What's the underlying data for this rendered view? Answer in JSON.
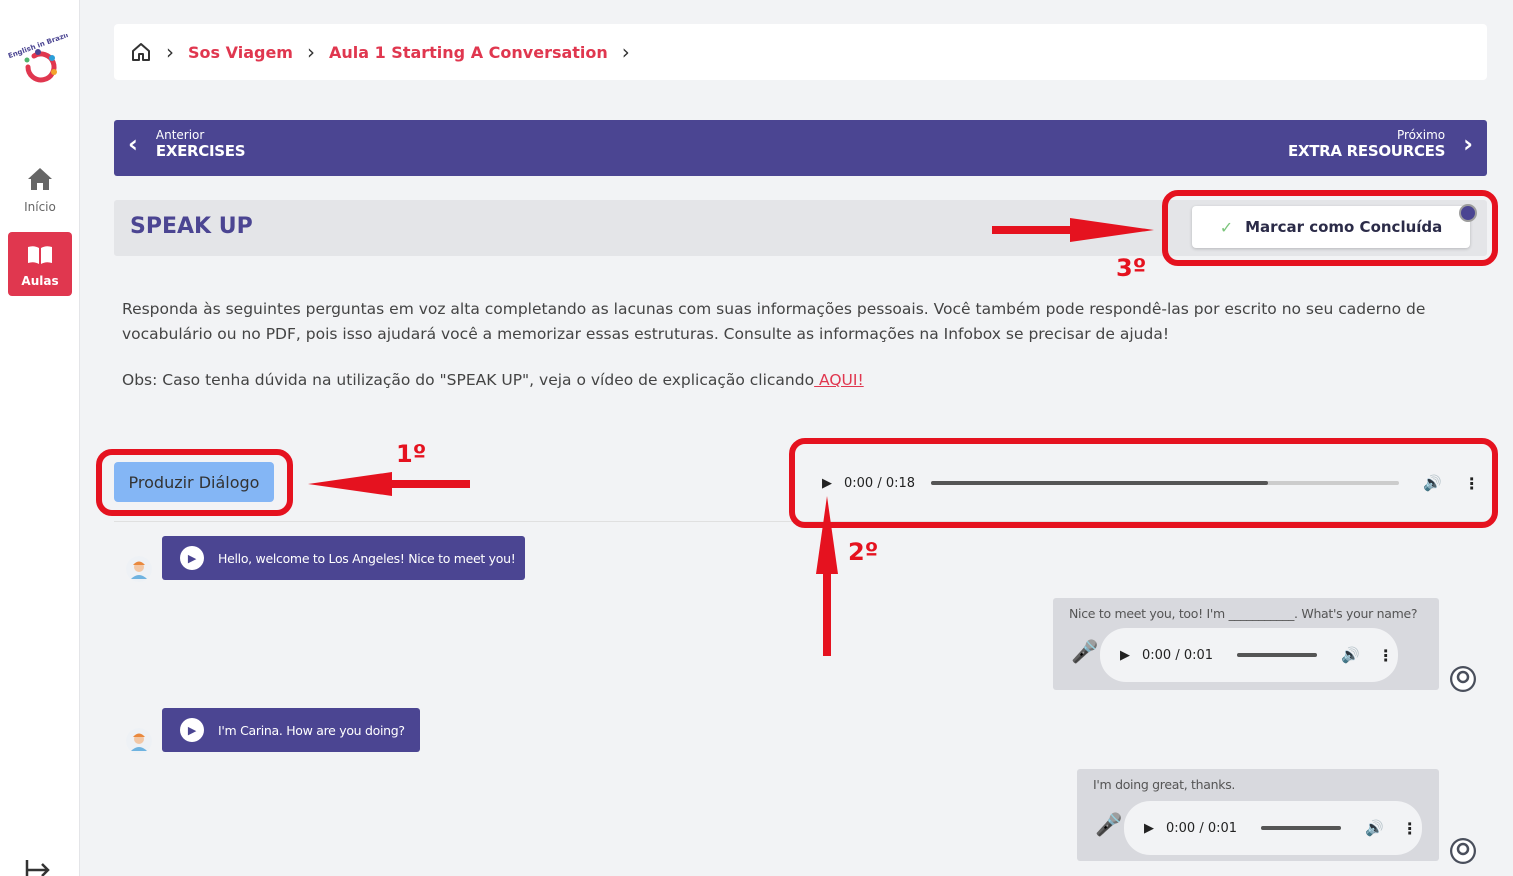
{
  "sidebar": {
    "logo_text": "English in Brazil",
    "items": [
      {
        "label": "Início",
        "icon": "home-icon"
      },
      {
        "label": "Aulas",
        "icon": "book-icon"
      }
    ]
  },
  "breadcrumb": {
    "items": [
      "Sos Viagem",
      "Aula 1 Starting A Conversation"
    ]
  },
  "lesson_nav": {
    "prev_small": "Anterior",
    "prev_title": "EXERCISES",
    "next_small": "Próximo",
    "next_title": "EXTRA RESOURCES"
  },
  "section": {
    "title": "SPEAK UP",
    "complete_label": "Marcar como Concluída"
  },
  "content": {
    "instructions": "Responda às seguintes perguntas em voz alta completando as lacunas com suas informações pessoais. Você também pode respondê-las por escrito no seu caderno de vocabulário ou no PDF, pois isso ajudará você a memorizar essas estruturas. Consulte as informações na Infobox se precisar de ajuda!",
    "obs_text": "Obs: Caso tenha dúvida na utilização do \"SPEAK UP\", veja o vídeo de explicação clicando",
    "obs_link": " AQUI!"
  },
  "produce_button": "Produzir Diálogo",
  "main_audio": {
    "time": "0:00 / 0:18",
    "progress": 0.72
  },
  "dialogue": [
    {
      "speaker": "bot",
      "text": "Hello, welcome to Los Angeles! Nice to meet you!"
    },
    {
      "speaker": "user",
      "prompt": "Nice to meet you, too! I'm ___________. What's your name?",
      "time": "0:00 / 0:01"
    },
    {
      "speaker": "bot",
      "text": "I'm Carina. How are you doing?"
    },
    {
      "speaker": "user",
      "prompt": "I'm doing great, thanks.",
      "time": "0:00 / 0:01"
    }
  ],
  "annotations": {
    "first": "1º",
    "second": "2º",
    "third": "3º",
    "color": "#e5121f"
  },
  "colors": {
    "primary": "#4b4592",
    "accent": "#e0374f",
    "produce_button": "#84b6f5"
  }
}
